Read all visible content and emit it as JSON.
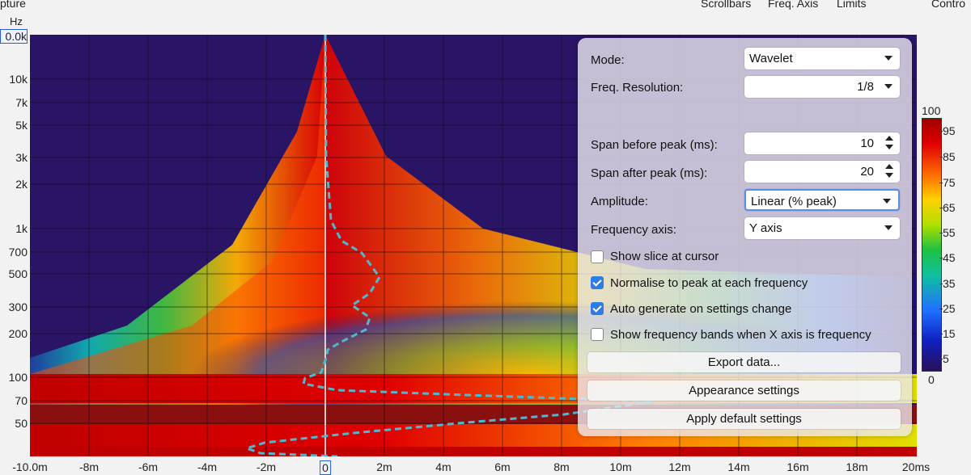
{
  "topbar": {
    "left_label": "pture",
    "scrollbars": "Scrollbars",
    "freq_axis": "Freq. Axis",
    "limits": "Limits",
    "controls": "Contro"
  },
  "y_axis": {
    "unit": "Hz",
    "ticks": [
      "0.0k",
      "10k",
      "7k",
      "5k",
      "3k",
      "2k",
      "1k",
      "700",
      "500",
      "300",
      "200",
      "100",
      "70",
      "50"
    ]
  },
  "x_axis": {
    "ticks": [
      "-10.0m",
      "-8m",
      "-6m",
      "-4m",
      "-2m",
      "0",
      "2m",
      "4m",
      "6m",
      "8m",
      "10m",
      "12m",
      "14m",
      "16m",
      "18m",
      "20ms"
    ]
  },
  "panel": {
    "mode_label": "Mode:",
    "mode_value": "Wavelet",
    "freq_res_label": "Freq. Resolution:",
    "freq_res_value": "1/8",
    "span_before_label": "Span before peak (ms):",
    "span_before_value": "10",
    "span_after_label": "Span after peak (ms):",
    "span_after_value": "20",
    "amplitude_label": "Amplitude:",
    "amplitude_value": "Linear (% peak)",
    "freq_axis_label": "Frequency axis:",
    "freq_axis_value": "Y axis",
    "show_slice": "Show slice at cursor",
    "show_slice_checked": false,
    "normalise": "Normalise to peak at each frequency",
    "normalise_checked": true,
    "auto_generate": "Auto generate on settings change",
    "auto_generate_checked": true,
    "show_bands": "Show frequency bands when X axis is frequency",
    "show_bands_checked": false,
    "export_button": "Export data...",
    "appearance_button": "Appearance settings",
    "default_button": "Apply default settings"
  },
  "colorbar": {
    "max": "100",
    "min": "0",
    "ticks": [
      "95",
      "85",
      "75",
      "65",
      "55",
      "45",
      "35",
      "25",
      "15",
      "5"
    ]
  },
  "colors": {
    "accent": "#2f7be8",
    "background_plot": "#2a1466",
    "peak_line": "#4fb8d0"
  }
}
